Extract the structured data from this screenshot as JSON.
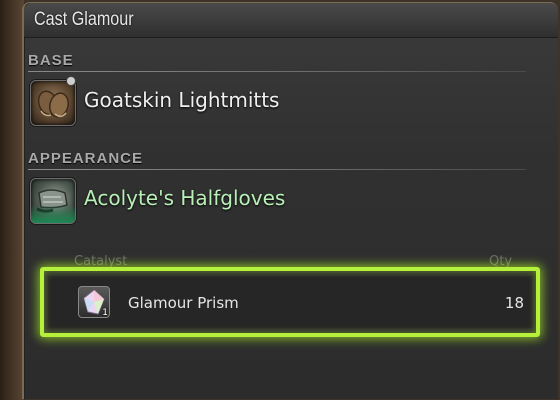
{
  "window": {
    "title": "Cast Glamour"
  },
  "base": {
    "section_label": "BASE",
    "item_name": "Goatskin Lightmitts",
    "icon": "leather-gloves-icon"
  },
  "appearance": {
    "section_label": "APPEARANCE",
    "item_name": "Acolyte's Halfgloves",
    "icon": "halfgloves-icon"
  },
  "catalyst": {
    "column_header": "Catalyst",
    "qty_header": "Qty",
    "item_name": "Glamour Prism",
    "quantity": "18",
    "icon_badge": "1",
    "icon": "glamour-prism-icon"
  },
  "colors": {
    "highlight": "#b5f03a",
    "appearance_text": "#b8f0b8",
    "section_label": "#a9a9a9"
  }
}
